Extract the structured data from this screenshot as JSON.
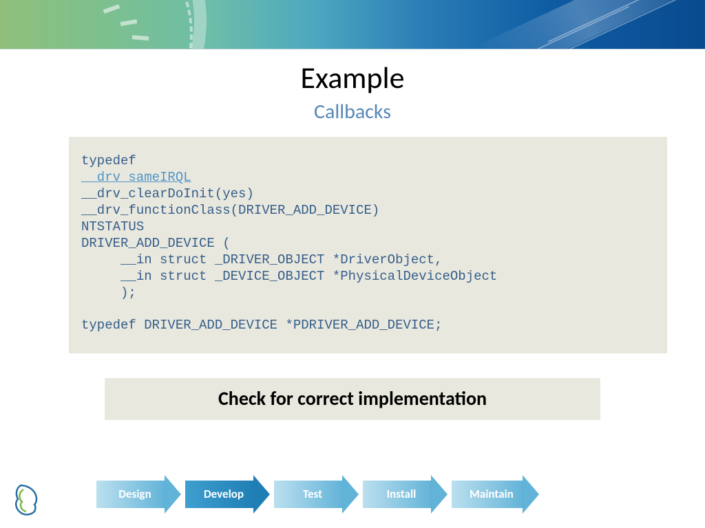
{
  "slide": {
    "title": "Example",
    "subtitle": "Callbacks"
  },
  "code": {
    "l1": "typedef",
    "l2": "__drv_sameIRQL",
    "l3": "__drv_clearDoInit(yes)",
    "l4": "__drv_functionClass(DRIVER_ADD_DEVICE)",
    "l5": "NTSTATUS",
    "l6": "DRIVER_ADD_DEVICE (",
    "l7": "     __in struct _DRIVER_OBJECT *DriverObject,",
    "l8": "     __in struct _DEVICE_OBJECT *PhysicalDeviceObject",
    "l9": "     );",
    "l10": "",
    "l11": "typedef DRIVER_ADD_DEVICE *PDRIVER_ADD_DEVICE;"
  },
  "callout": {
    "text": "Check for correct implementation"
  },
  "workflow": {
    "steps": [
      {
        "label": "Design",
        "active": false
      },
      {
        "label": "Develop",
        "active": true
      },
      {
        "label": "Test",
        "active": false
      },
      {
        "label": "Install",
        "active": false
      },
      {
        "label": "Maintain",
        "active": false
      }
    ]
  }
}
